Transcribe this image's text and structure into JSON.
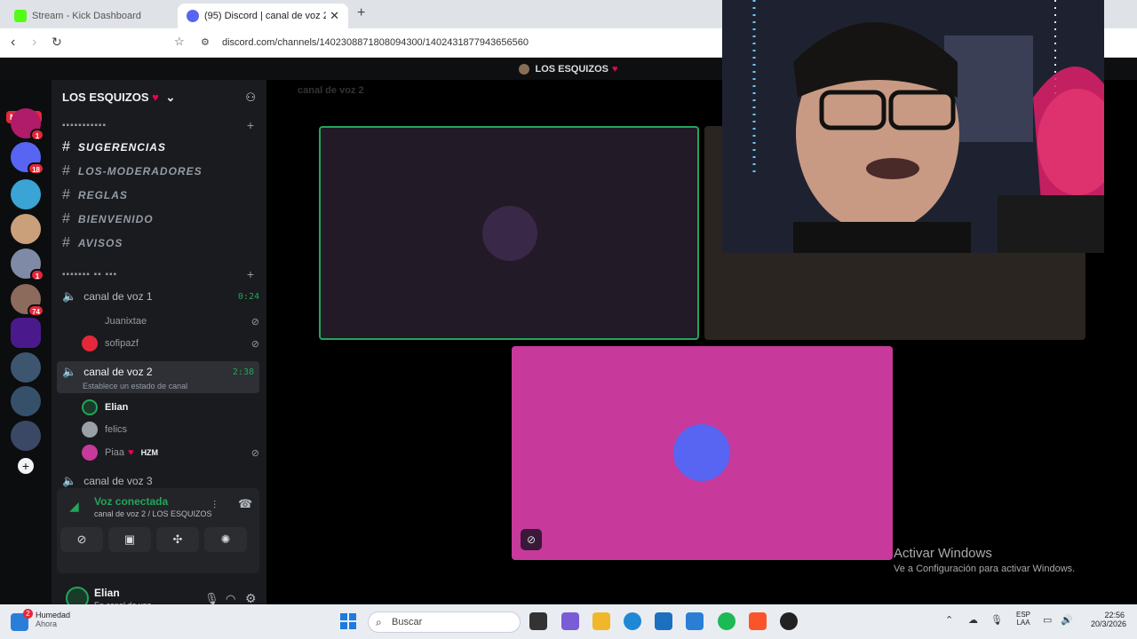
{
  "browser": {
    "tab_inactive": "Stream - Kick Dashboard",
    "tab_active": "(95) Discord | canal de voz 2 |",
    "url": "discord.com/channels/1402308871808094300/1402431877943656560"
  },
  "discord": {
    "top_title": "LOS ESQUIZOS",
    "nuevo": "NUEVO",
    "guild_badges": [
      "1",
      "18",
      "1",
      "74"
    ],
    "server_name": "LOS ESQUIZOS",
    "category1": "▪▪▪▪▪▪▪▪▪▪▪",
    "text_channels": [
      "SUGERENCIAS",
      "LOS-MODERADORES",
      "REGLAS",
      "BIENVENIDO",
      "AVISOS"
    ],
    "category2": "▪▪▪▪▪▪▪ ▪▪ ▪▪▪",
    "voice1": {
      "name": "canal de voz 1",
      "time": "0:24"
    },
    "voice1_users": [
      "Juanixtae",
      "sofipazf"
    ],
    "voice2": {
      "name": "canal de voz 2",
      "time": "2:38",
      "status": "Establece un estado de canal"
    },
    "voice2_users": [
      "Elian",
      "felics",
      "Piaa"
    ],
    "voice2_tag": "HZM",
    "voice3": "canal de voz 3",
    "voice_connected": "Voz conectada",
    "voice_sub": "canal de voz 2 / LOS ESQUIZOS",
    "user_name": "Elian",
    "user_status": "En canal de voz",
    "stage_title": "canal de voz 2"
  },
  "watermark": {
    "line1": "Activar Windows",
    "line2": "Ve a Configuración para activar Windows."
  },
  "taskbar": {
    "weather_badge": "2",
    "weather_title": "Humedad",
    "weather_sub": "Ahora",
    "search": "Buscar",
    "lang1": "ESP",
    "lang2": "LAA",
    "time": "22:56",
    "date": "20/3/2026"
  },
  "colors": {
    "green": "#23a55a",
    "pink": "#c7399b",
    "red_badge": "#e3283a"
  }
}
